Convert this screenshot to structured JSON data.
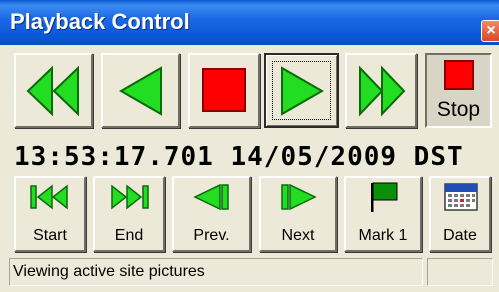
{
  "window": {
    "title": "Playback Control",
    "close_glyph": "×"
  },
  "transport": {
    "rewind": {
      "icon": "rewind-icon"
    },
    "reverse": {
      "icon": "play-reverse-icon"
    },
    "stop_button": {
      "icon": "stop-square-icon"
    },
    "play": {
      "icon": "play-icon"
    },
    "fast_forward": {
      "icon": "fast-forward-icon"
    },
    "stop_toggle": {
      "icon": "stop-square-icon",
      "label": "Stop"
    }
  },
  "timestamp": {
    "text": "13:53:17.701 14/05/2009 DST"
  },
  "navigation": {
    "start": {
      "icon": "skip-to-start-icon",
      "label": "Start"
    },
    "end": {
      "icon": "skip-to-end-icon",
      "label": "End"
    },
    "prev": {
      "icon": "step-back-icon",
      "label": "Prev."
    },
    "next": {
      "icon": "step-forward-icon",
      "label": "Next"
    },
    "mark": {
      "icon": "flag-icon",
      "label": "Mark 1"
    },
    "date": {
      "icon": "calendar-icon",
      "label": "Date"
    }
  },
  "status_bar": {
    "text": "Viewing active site pictures",
    "secondary": ""
  },
  "colors": {
    "title_bar": "#1c6ae6",
    "face": "#ece9d8",
    "icon_green": "#22dd22",
    "icon_green_dark": "#0a6b0a",
    "stop_red": "#ff0000",
    "close_red": "#d9482a"
  }
}
